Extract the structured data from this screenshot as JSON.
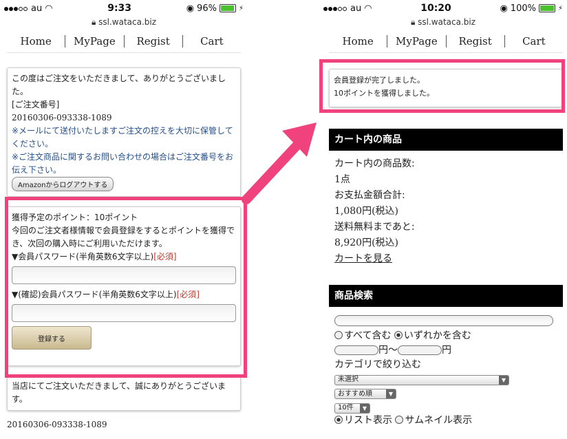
{
  "left": {
    "status": {
      "carrier": "au",
      "time": "9:33",
      "battery": "96%"
    },
    "url": "ssl.wataca.biz",
    "nav": [
      "Home",
      "MyPage",
      "Regist",
      "Cart"
    ],
    "thanks": "この度はご注文をいただきまして、ありがとうございました。",
    "order_label": "[ご注文番号]",
    "order_number": "20160306-093338-1089",
    "note1": "※メールにて送付いたしますご注文の控えを大切に保管してください。",
    "note2": "※ご注文商品に関するお問い合わせの場合はご注文番号をお伝え下さい。",
    "logout_button": "Amazonからログアウトする",
    "points": "獲得予定のポイント：10ポイント",
    "register_text": "今回のご注文者様情報で会員登録をするとポイントを獲得でき、次回の購入時にご利用いただけます。",
    "pw_label": "▼会員パスワード(半角英数6文字以上)",
    "required": "[必須]",
    "pw_confirm_label": "▼(確認)会員パスワード(半角英数6文字以上)",
    "register_button": "登録する",
    "shop_thanks": "当店にてご注文いただきまして、誠にありがとうございます。",
    "order_number_footer": "20160306-093338-1089"
  },
  "right": {
    "status": {
      "carrier": "au",
      "time": "10:20",
      "battery": "100%"
    },
    "url": "ssl.wataca.biz",
    "nav": [
      "Home",
      "MyPage",
      "Regist",
      "Cart"
    ],
    "complete1": "会員登録が完了しました。",
    "complete2": "10ポイントを獲得しました。",
    "cart_head": "カート内の商品",
    "cart_count_label": "カート内の商品数:",
    "cart_count": "1点",
    "total_label": "お支払金額合計:",
    "total": "1,080円(税込)",
    "free_ship_label": "送料無料まであと:",
    "free_ship": "8,920円(税込)",
    "view_cart": "カートを見る",
    "search_head": "商品検索",
    "all": "すべて含む",
    "any": "いずれかを含む",
    "yen_from": "円〜",
    "yen_to": "円",
    "category_filter": "カテゴリで絞り込む",
    "category_select": "未選択",
    "sort_select": "おすすめ順",
    "count_select": "10件",
    "list_view": "リスト表示",
    "thumb_view": "サムネイル表示"
  },
  "colors": {
    "highlight": "#f0437e",
    "header_bg": "#000000",
    "link_blue": "#24508c",
    "required_red": "#c0392b"
  }
}
